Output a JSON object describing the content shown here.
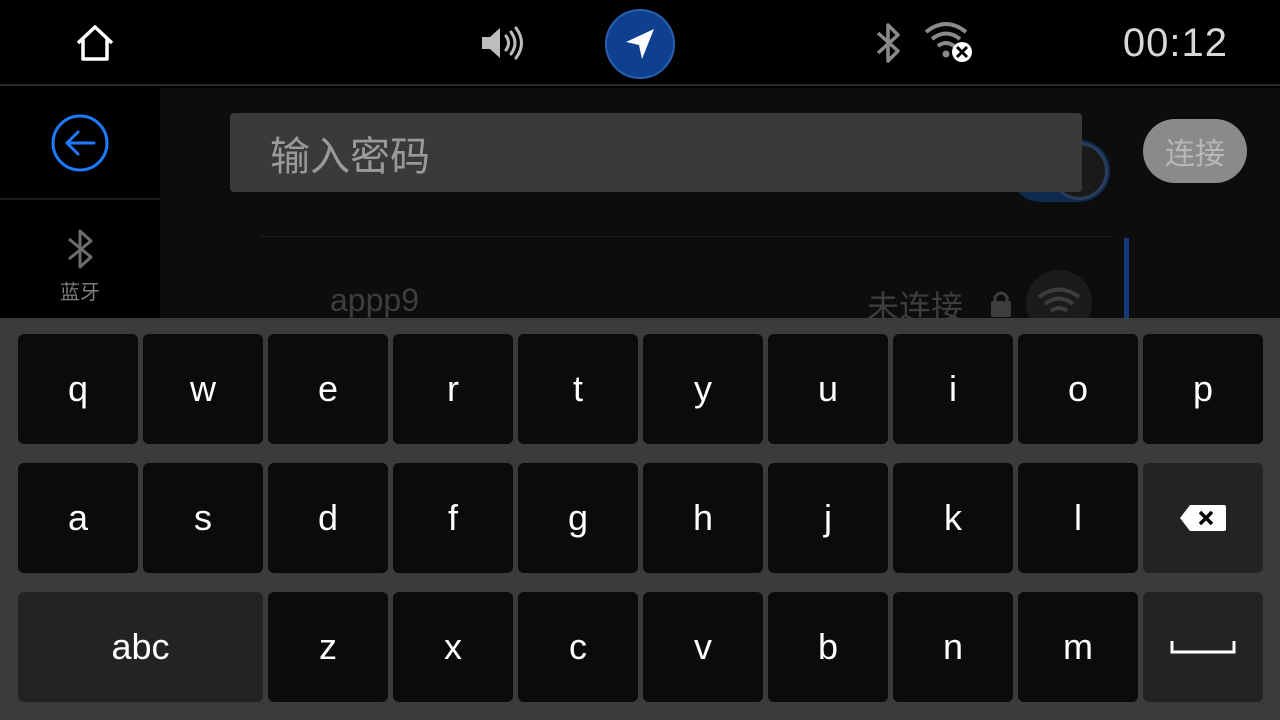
{
  "status_bar": {
    "time": "00:12",
    "icons": [
      "home-icon",
      "volume-icon",
      "navigation-icon",
      "bluetooth-icon",
      "wifi-disconnected-icon"
    ],
    "nav_color": "#0f3f8f"
  },
  "sidebar": {
    "back_icon_color": "#1e7bff",
    "bluetooth_label": "蓝牙"
  },
  "background_list": {
    "network_name": "appp9",
    "network_status": "未连接"
  },
  "password": {
    "placeholder": "输入密码",
    "connect_label": "连接"
  },
  "keyboard": {
    "row1": [
      "q",
      "w",
      "e",
      "r",
      "t",
      "y",
      "u",
      "i",
      "o",
      "p"
    ],
    "row2": [
      "a",
      "s",
      "d",
      "f",
      "g",
      "h",
      "j",
      "k",
      "l"
    ],
    "row3": [
      "z",
      "x",
      "c",
      "v",
      "b",
      "n",
      "m"
    ],
    "mode_label": "abc",
    "backspace_icon": "backspace-icon",
    "space_icon": "space-icon"
  }
}
